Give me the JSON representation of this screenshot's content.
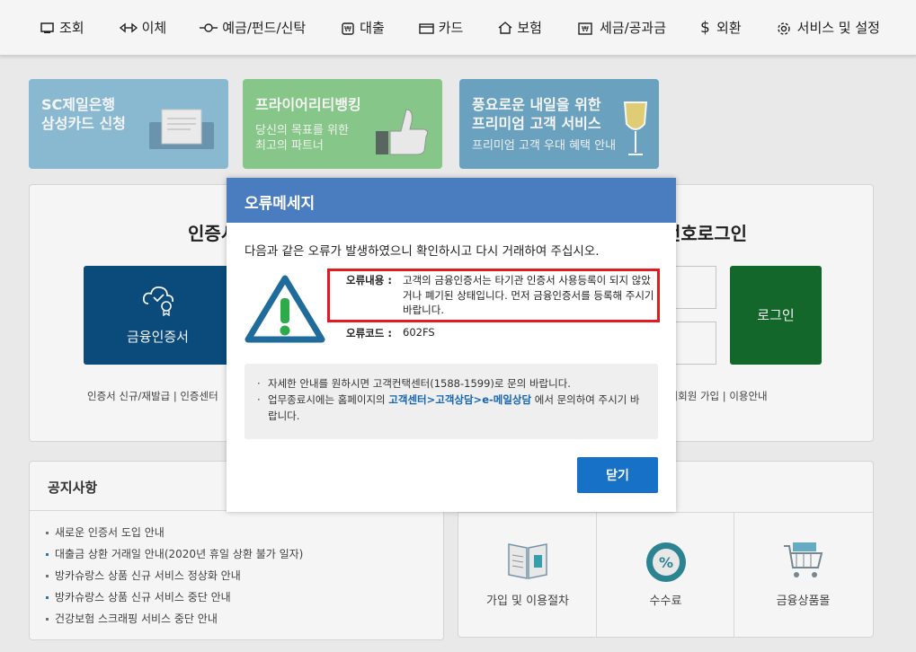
{
  "nav": {
    "items": [
      {
        "label": "조회",
        "icon": "inquiry-icon"
      },
      {
        "label": "이체",
        "icon": "transfer-icon"
      },
      {
        "label": "예금/펀드/신탁",
        "icon": "deposit-icon"
      },
      {
        "label": "대출",
        "icon": "loan-icon"
      },
      {
        "label": "카드",
        "icon": "card-icon"
      },
      {
        "label": "보험",
        "icon": "insurance-icon"
      },
      {
        "label": "세금/공과금",
        "icon": "tax-icon"
      },
      {
        "label": "외환",
        "icon": "dollar-icon"
      },
      {
        "label": "서비스 및 설정",
        "icon": "gear-icon"
      }
    ]
  },
  "banners": [
    {
      "line1": "SC제일은행",
      "line2": "삼성카드 신청",
      "sub": ""
    },
    {
      "line1": "프라이어리티뱅킹",
      "line2": "",
      "sub1": "당신의 목표를 위한",
      "sub2": "최고의 파트너"
    },
    {
      "line1": "풍요로운 내일을 위한",
      "line2": "프리미엄 고객 서비스",
      "sub": "프리미엄 고객 우대 혜택 안내"
    }
  ],
  "login": {
    "title_left": "인증서",
    "title_right": "번호로그인",
    "cert_button": "금융인증서",
    "login_button": "로그인",
    "links_left": "인증서 신규/재발급  |  인증센터",
    "links_right": "조회회원 가입   |   이용안내"
  },
  "notice": {
    "title": "공지사항",
    "items": [
      "새로운 인증서 도입 안내",
      "대출금 상환 거래일 안내(2020년 휴일 상환 불가 일자)",
      "방카슈랑스 상품 신규 서비스 정상화 안내",
      "방카슈랑스 상품 신규 서비스 중단 안내",
      "건강보험 스크래핑 서비스 중단 안내"
    ]
  },
  "services": [
    {
      "label": "가입 및 이용절차",
      "icon": "book-icon"
    },
    {
      "label": "수수료",
      "icon": "percent-icon"
    },
    {
      "label": "금융상품몰",
      "icon": "cart-icon"
    }
  ],
  "modal": {
    "title": "오류메세지",
    "message": "다음과 같은 오류가 발생하였으니 확인하시고 다시 거래하여 주십시오.",
    "error_label": "오류내용 :",
    "error_text": "고객의 금융인증서는 타기관 인증서 사용등록이 되지 않았거나 폐기된 상태입니다. 먼저 금융인증서를 등록해 주시기 바랍니다.",
    "code_label": "오류코드 :",
    "code_value": "602FS",
    "info1": "자세한 안내를 원하시면 고객컨택센터(1588-1599)로 문의 바랍니다.",
    "info2_pre": "업무종료시에는 홈페이지의 ",
    "info2_link": "고객센터>고객상담>e-메일상담",
    "info2_post": " 에서 문의하여 주시기 바랍니다.",
    "close_button": "닫기"
  }
}
